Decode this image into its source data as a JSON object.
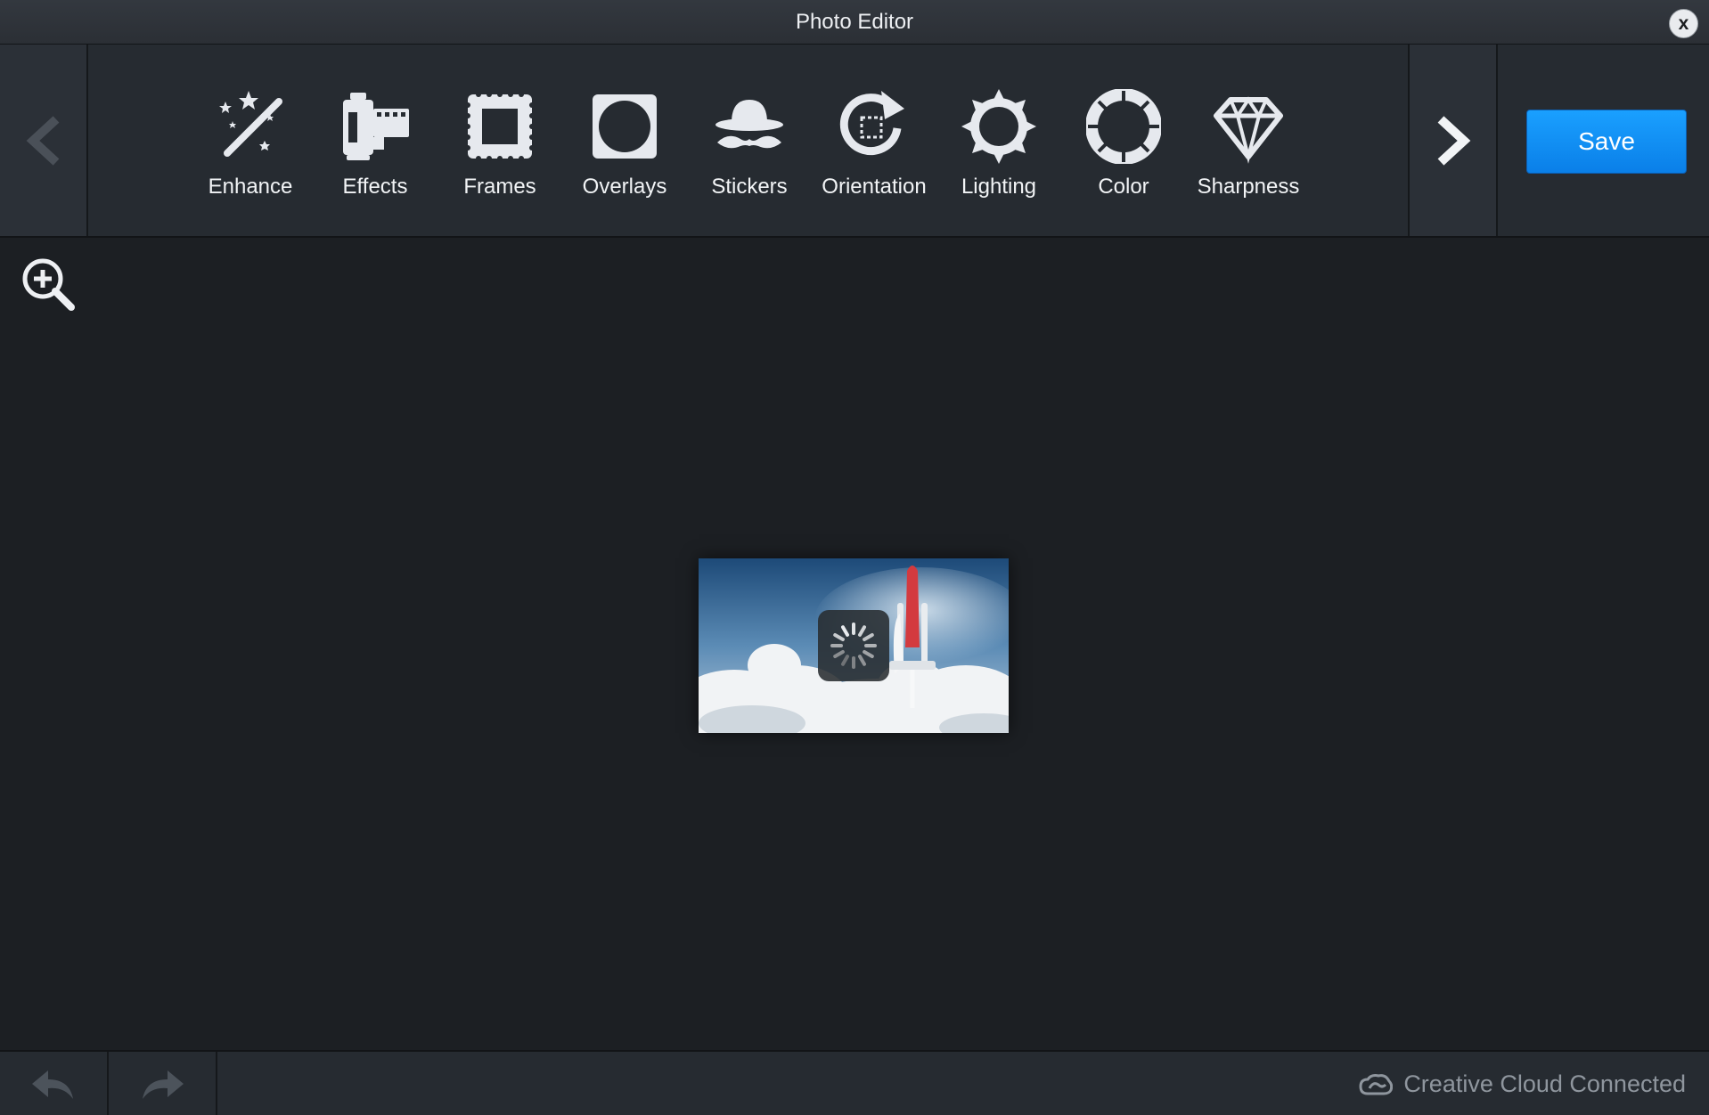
{
  "window": {
    "title": "Photo Editor",
    "close_label": "x"
  },
  "toolbar": {
    "save_label": "Save",
    "tools": [
      {
        "label": "Enhance",
        "icon": "magic-wand-icon"
      },
      {
        "label": "Effects",
        "icon": "film-canister-icon"
      },
      {
        "label": "Frames",
        "icon": "frame-icon"
      },
      {
        "label": "Overlays",
        "icon": "overlay-circle-icon"
      },
      {
        "label": "Stickers",
        "icon": "hat-mustache-icon"
      },
      {
        "label": "Orientation",
        "icon": "rotate-icon"
      },
      {
        "label": "Lighting",
        "icon": "sun-icon"
      },
      {
        "label": "Color",
        "icon": "color-wheel-icon"
      },
      {
        "label": "Sharpness",
        "icon": "diamond-icon"
      }
    ]
  },
  "status": {
    "cloud_label": "Creative Cloud Connected"
  },
  "colors": {
    "accent": "#0a8af5",
    "background": "#1c1f23",
    "toolbar": "#262b31"
  }
}
